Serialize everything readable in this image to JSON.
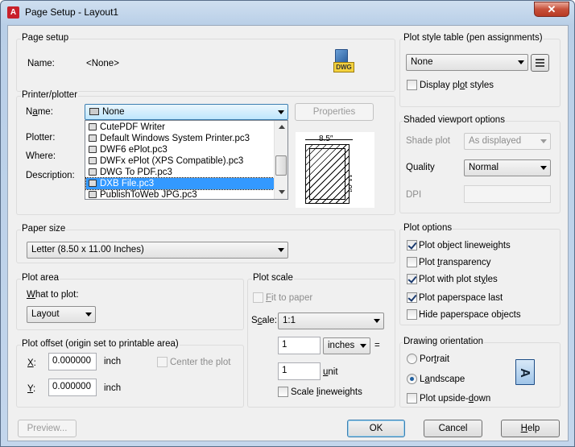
{
  "window": {
    "title": "Page Setup - Layout1",
    "close_glyph": "✕",
    "app_icon_letter": "A"
  },
  "page_setup": {
    "group_title": "Page setup",
    "name_label": "Name:",
    "name_value": "<None>",
    "badge": "DWG"
  },
  "printer": {
    "group_title": "Printer/plotter",
    "name_label": "Name:",
    "name_value": "None",
    "properties_label": "Properties",
    "plotter_label": "Plotter:",
    "where_label": "Where:",
    "description_label": "Description:",
    "options": [
      "CutePDF Writer",
      "Default Windows System Printer.pc3",
      "DWF6 ePlot.pc3",
      "DWFx ePlot (XPS Compatible).pc3",
      "DWG To PDF.pc3",
      "DXB File.pc3",
      "PublishToWeb JPG.pc3"
    ],
    "selected_option": "DXB File.pc3",
    "preview_width": "8.5″",
    "preview_height": "11.0″"
  },
  "paper_size": {
    "group_title": "Paper size",
    "value": "Letter (8.50 x 11.00 Inches)"
  },
  "plot_area": {
    "group_title": "Plot area",
    "what_label": "What to plot:",
    "value": "Layout"
  },
  "plot_offset": {
    "group_title": "Plot offset (origin set to printable area)",
    "x_label": "X:",
    "x_value": "0.000000",
    "x_unit": "inch",
    "y_label": "Y:",
    "y_value": "0.000000",
    "y_unit": "inch",
    "center_label": "Center the plot",
    "center_checked": false
  },
  "plot_scale": {
    "group_title": "Plot scale",
    "fit_label": "Fit to paper",
    "fit_checked": false,
    "scale_label": "Scale:",
    "scale_value": "1:1",
    "value1": "1",
    "unit1": "inches",
    "equals": "=",
    "value2": "1",
    "unit2": "unit",
    "lineweights_label": "Scale lineweights",
    "lineweights_checked": false
  },
  "plot_style_table": {
    "group_title": "Plot style table (pen assignments)",
    "value": "None",
    "display_label": "Display plot styles",
    "display_checked": false
  },
  "shaded_viewport": {
    "group_title": "Shaded viewport options",
    "shade_label": "Shade plot",
    "shade_value": "As displayed",
    "quality_label": "Quality",
    "quality_value": "Normal",
    "dpi_label": "DPI",
    "dpi_value": ""
  },
  "plot_options": {
    "group_title": "Plot options",
    "items": [
      {
        "label": "Plot object lineweights",
        "checked": true
      },
      {
        "label": "Plot transparency",
        "checked": false
      },
      {
        "label": "Plot with plot styles",
        "checked": true
      },
      {
        "label": "Plot paperspace last",
        "checked": true
      },
      {
        "label": "Hide paperspace objects",
        "checked": false
      }
    ]
  },
  "drawing_orientation": {
    "group_title": "Drawing orientation",
    "portrait_label": "Portrait",
    "landscape_label": "Landscape",
    "selected": "Landscape",
    "upside_label": "Plot upside-down",
    "upside_checked": false,
    "preview_letter": "A"
  },
  "footer": {
    "preview_label": "Preview...",
    "ok_label": "OK",
    "cancel_label": "Cancel",
    "help_label": "Help"
  }
}
